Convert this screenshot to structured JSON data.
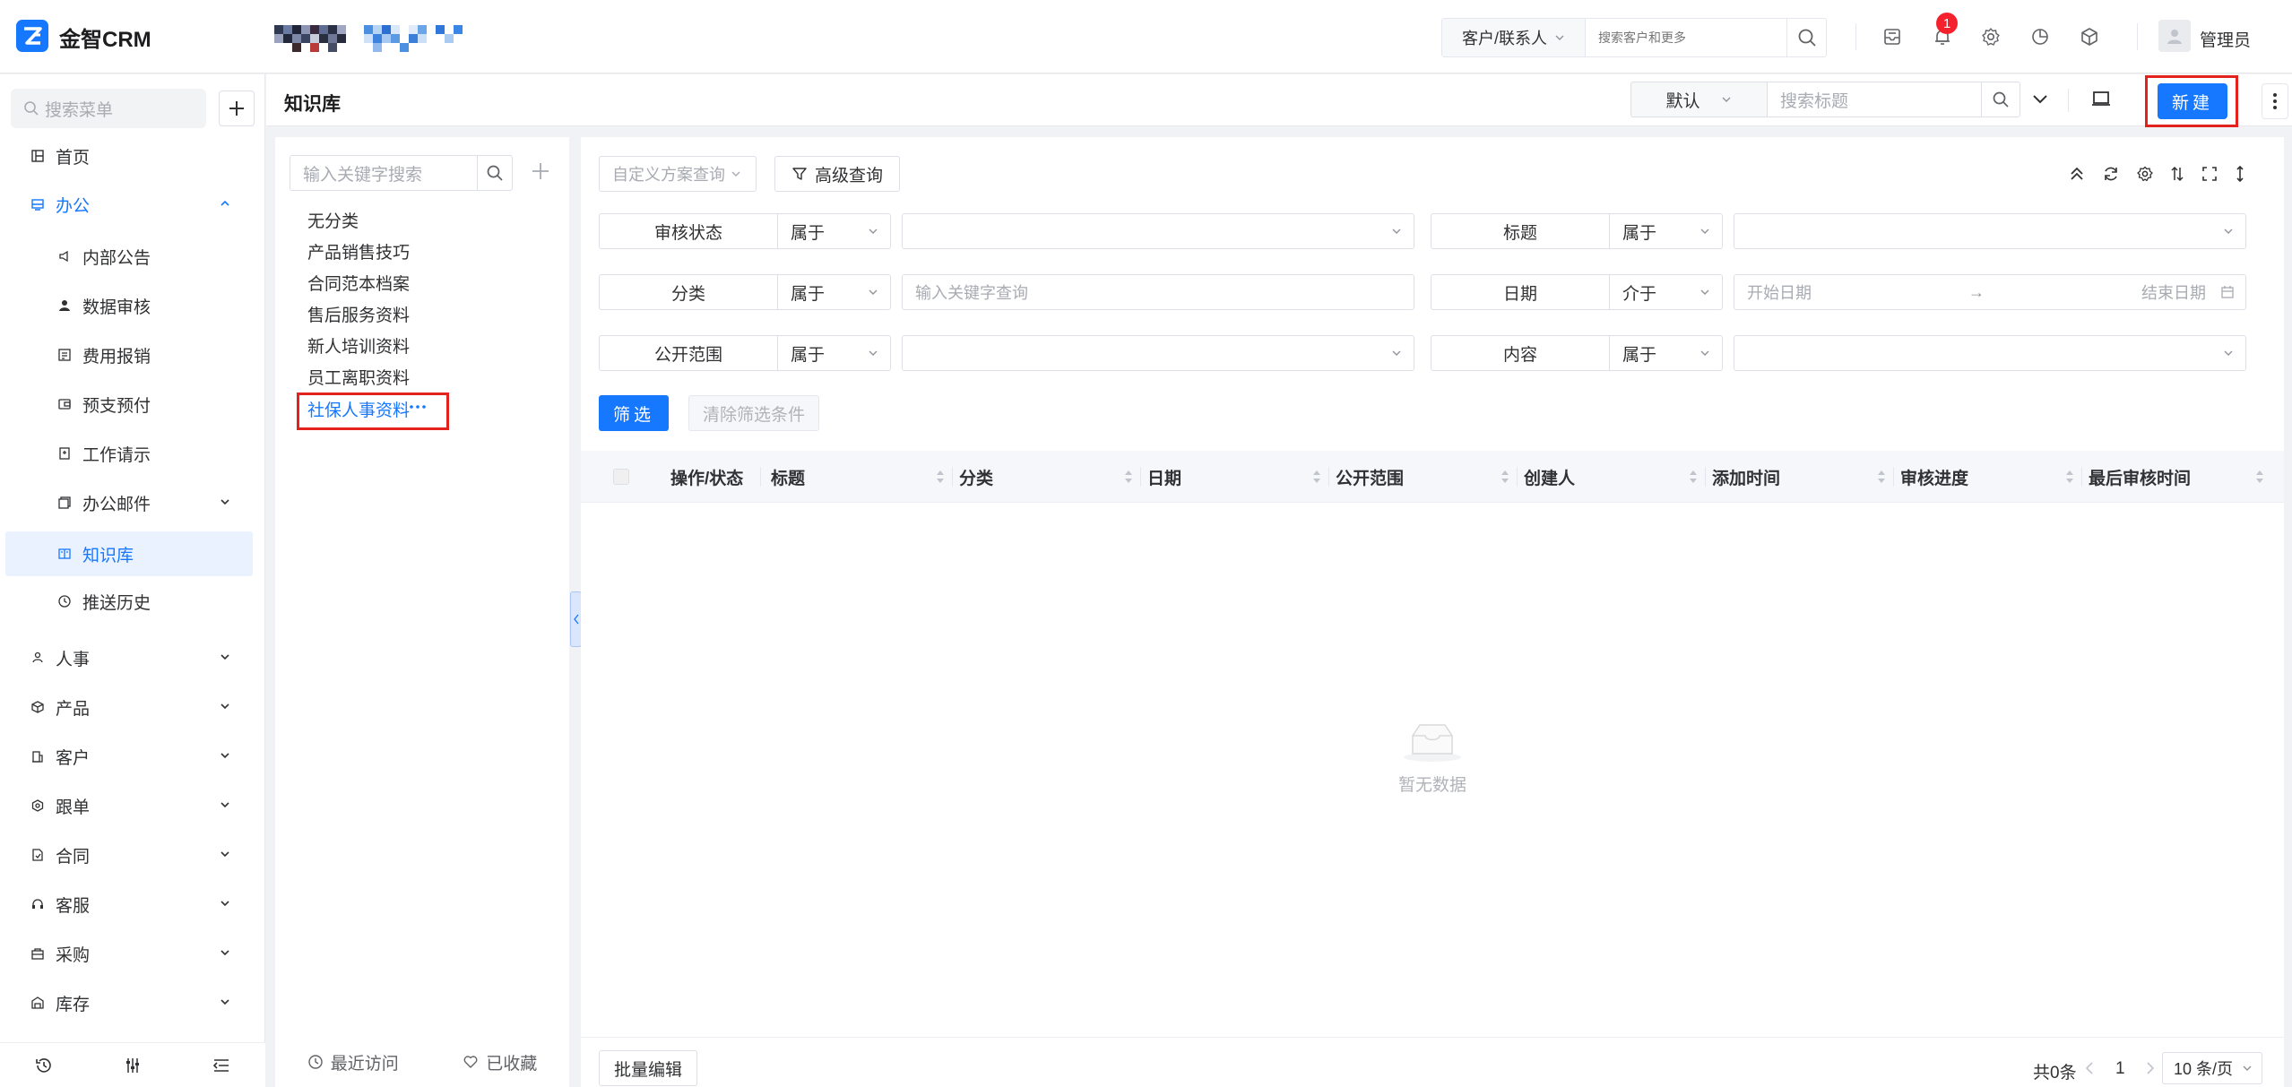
{
  "app": {
    "name": "金智CRM",
    "brand_color": "#1677ff"
  },
  "topbar": {
    "search_scope": "客户/联系人",
    "search_placeholder": "搜索客户和更多",
    "notification_count": "1",
    "user_name": "管理员",
    "icons": [
      "inbox-icon",
      "bell-icon",
      "gear-icon",
      "pie-chart-icon",
      "cube-icon"
    ]
  },
  "sidebar": {
    "search_placeholder": "搜索菜单",
    "items": [
      {
        "label": "首页",
        "icon": "home-icon"
      },
      {
        "label": "办公",
        "icon": "office-icon",
        "expanded": true
      },
      {
        "label": "内部公告",
        "icon": "megaphone-icon"
      },
      {
        "label": "数据审核",
        "icon": "user-check-icon"
      },
      {
        "label": "费用报销",
        "icon": "receipt-icon"
      },
      {
        "label": "预支预付",
        "icon": "wallet-icon"
      },
      {
        "label": "工作请示",
        "icon": "clipboard-icon"
      },
      {
        "label": "办公邮件",
        "icon": "mail-icon"
      },
      {
        "label": "知识库",
        "icon": "book-icon",
        "active": true
      },
      {
        "label": "推送历史",
        "icon": "clock-icon"
      },
      {
        "label": "人事",
        "icon": "people-icon"
      },
      {
        "label": "产品",
        "icon": "box-icon"
      },
      {
        "label": "客户",
        "icon": "building-icon"
      },
      {
        "label": "跟单",
        "icon": "hexagon-icon"
      },
      {
        "label": "合同",
        "icon": "document-icon"
      },
      {
        "label": "客服",
        "icon": "headset-icon"
      },
      {
        "label": "采购",
        "icon": "bag-icon"
      },
      {
        "label": "库存",
        "icon": "warehouse-icon"
      }
    ]
  },
  "header": {
    "title": "知识库",
    "view_select": "默认",
    "search_placeholder": "搜索标题",
    "new_button": "新建"
  },
  "categories": {
    "search_placeholder": "输入关键字搜索",
    "items": [
      "无分类",
      "产品销售技巧",
      "合同范本档案",
      "售后服务资料",
      "新人培训资料",
      "员工离职资料",
      "社保人事资料"
    ],
    "selected": "社保人事资料",
    "footer": {
      "recent": "最近访问",
      "favorites": "已收藏"
    }
  },
  "filters": {
    "scheme_placeholder": "自定义方案查询",
    "advanced_label": "高级查询",
    "rows": [
      {
        "label": "审核状态",
        "op": "属于",
        "value": "",
        "label2": "标题",
        "op2": "属于",
        "value2": ""
      },
      {
        "label": "分类",
        "op": "属于",
        "value": "输入关键字查询",
        "label2": "日期",
        "op2": "介于",
        "start": "开始日期",
        "arrow": "→",
        "end": "结束日期"
      },
      {
        "label": "公开范围",
        "op": "属于",
        "value": "",
        "label2": "内容",
        "op2": "属于",
        "value2": ""
      }
    ],
    "filter_button": "筛选",
    "clear_button": "清除筛选条件"
  },
  "table": {
    "columns": [
      "操作/状态",
      "标题",
      "分类",
      "日期",
      "公开范围",
      "创建人",
      "添加时间",
      "审核进度",
      "最后审核时间"
    ],
    "empty_text": "暂无数据"
  },
  "footer": {
    "batch_edit": "批量编辑",
    "total": "共0条",
    "page": "1",
    "page_size": "10 条/页"
  },
  "highlight_color": "#e3211d"
}
